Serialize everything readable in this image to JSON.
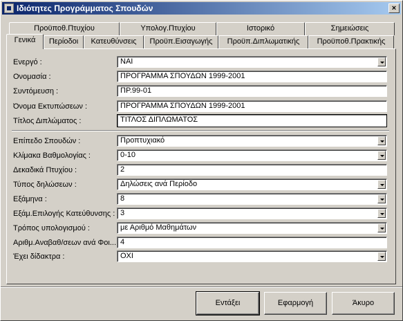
{
  "window": {
    "title": "Ιδιότητες Προγράμματος Σπουδών",
    "close_label": "×"
  },
  "tabs_back": [
    {
      "label": "Προϋποθ.Πτυχίου"
    },
    {
      "label": "Υπολογ.Πτυχίου"
    },
    {
      "label": "Ιστορικό"
    },
    {
      "label": "Σημειώσεις"
    }
  ],
  "tabs_front": [
    {
      "label": "Γενικά"
    },
    {
      "label": "Περίοδοι"
    },
    {
      "label": "Κατευθύνσεις"
    },
    {
      "label": "Προϋπ.Εισαγωγής"
    },
    {
      "label": "Προϋπ.Διπλωματικής"
    },
    {
      "label": "Προϋποθ.Πρακτικής"
    }
  ],
  "form": {
    "energo": {
      "label": "Ενεργό :",
      "value": "ΝΑΙ"
    },
    "onomasia": {
      "label": "Ονομασία :",
      "value": "ΠΡΟΓΡΑΜΜΑ ΣΠΟΥΔΩΝ 1999-2001"
    },
    "syntomeusi": {
      "label": "Συντόμευση :",
      "value": "ΠΡ.99-01"
    },
    "onoma_ektyposeon": {
      "label": "Όνομα Εκτυπώσεων :",
      "value": "ΠΡΟΓΡΑΜΜΑ ΣΠΟΥΔΩΝ 1999-2001"
    },
    "titlos_diplomatos": {
      "label": "Τίτλος Διπλώματος :",
      "value": "ΤΙΤΛΟΣ ΔΙΠΛΩΜΑΤΟΣ"
    },
    "epipedo_spoudon": {
      "label": "Επίπεδο Σπουδών :",
      "value": "Προπτυχιακό"
    },
    "klimaka": {
      "label": "Κλίμακα Βαθμολογίας :",
      "value": "0-10"
    },
    "dekadika": {
      "label": "Δεκαδικά Πτυχίου :",
      "value": "2"
    },
    "typos_diloseon": {
      "label": "Τύπος δηλώσεων :",
      "value": "Δηλώσεις ανά Περίοδο"
    },
    "examina": {
      "label": "Εξάμηνα :",
      "value": "8"
    },
    "examino_epilogis": {
      "label": "Εξάμ.Επιλογής Κατεύθυνσης :",
      "value": "3"
    },
    "tropos": {
      "label": "Τρόπος υπολογισμού :",
      "value": "με Αριθμό Μαθημάτων"
    },
    "arithmos_anavath": {
      "label": "Αριθμ.Αναβαθ/σεων ανά Φοι...",
      "value": "4"
    },
    "didaktra": {
      "label": "Έχει δίδακτρα :",
      "value": "ΟΧΙ"
    }
  },
  "buttons": {
    "ok": "Εντάξει",
    "apply": "Εφαρμογή",
    "cancel": "Άκυρο"
  }
}
